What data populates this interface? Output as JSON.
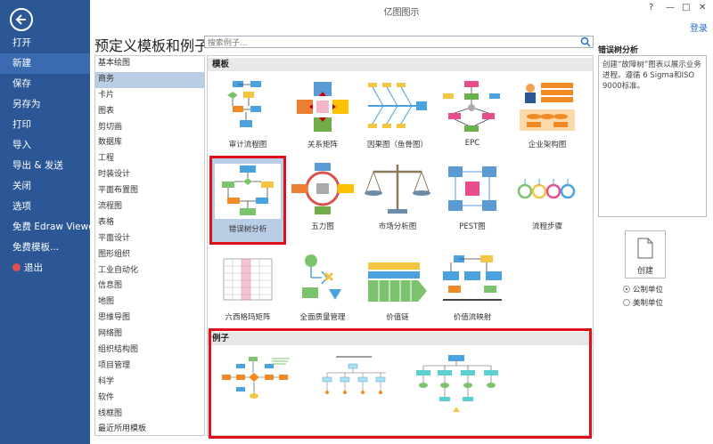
{
  "window": {
    "title": "亿图图示",
    "login": "登录",
    "controls": [
      "?",
      "—",
      "□",
      "✕"
    ]
  },
  "sidebar": {
    "items": [
      {
        "label": "打开"
      },
      {
        "label": "新建",
        "active": true
      },
      {
        "label": "保存"
      },
      {
        "label": "另存为"
      },
      {
        "label": "打印"
      },
      {
        "label": "导入"
      },
      {
        "label": "导出 & 发送"
      },
      {
        "label": "关闭"
      },
      {
        "label": "选项"
      },
      {
        "label": "免费 Edraw Viewer"
      },
      {
        "label": "免费模板..."
      },
      {
        "label": "退出"
      }
    ]
  },
  "header": {
    "title": "预定义模板和例子",
    "search_placeholder": "搜索例子..."
  },
  "categories": [
    "基本绘图",
    "商务",
    "卡片",
    "图表",
    "剪切画",
    "数据库",
    "工程",
    "时装设计",
    "平面布置图",
    "流程图",
    "表格",
    "平面设计",
    "图形组织",
    "工业自动化",
    "信息图",
    "地图",
    "思维导图",
    "网络图",
    "组织结构图",
    "项目管理",
    "科学",
    "软件",
    "线框图",
    "最近所用模板"
  ],
  "selected_category": "商务",
  "main": {
    "templates_header": "模板",
    "examples_header": "例子",
    "templates": [
      {
        "label": "审计流程图",
        "icon": "audit-flowchart-icon"
      },
      {
        "label": "关系矩阵",
        "icon": "relation-matrix-icon"
      },
      {
        "label": "因果图（鱼骨图）",
        "icon": "fishbone-icon"
      },
      {
        "label": "EPC",
        "icon": "epc-icon"
      },
      {
        "label": "企业架构图",
        "icon": "enterprise-architecture-icon"
      },
      {
        "label": "错误树分析",
        "icon": "fault-tree-icon",
        "selected": true
      },
      {
        "label": "五力图",
        "icon": "five-forces-icon"
      },
      {
        "label": "市场分析图",
        "icon": "market-analysis-icon"
      },
      {
        "label": "PEST图",
        "icon": "pest-icon"
      },
      {
        "label": "流程步骤",
        "icon": "process-steps-icon"
      },
      {
        "label": "六西格玛矩阵",
        "icon": "six-sigma-icon"
      },
      {
        "label": "全面质量管理",
        "icon": "tqm-icon"
      },
      {
        "label": "价值链",
        "icon": "value-chain-icon"
      },
      {
        "label": "价值流映射",
        "icon": "value-stream-icon"
      }
    ]
  },
  "right_panel": {
    "title": "错误树分析",
    "description": "创建“故障树”图表以展示业务进程。遵循 6 Sigma和ISO 9000标准。",
    "create_label": "创建",
    "units": [
      {
        "label": "公制单位",
        "checked": true
      },
      {
        "label": "美制单位",
        "checked": false
      }
    ]
  },
  "colors": {
    "sidebar": "#2b5797",
    "selection": "#b9cde5",
    "highlight_border": "#e0101a",
    "link": "#2b6cc4"
  }
}
